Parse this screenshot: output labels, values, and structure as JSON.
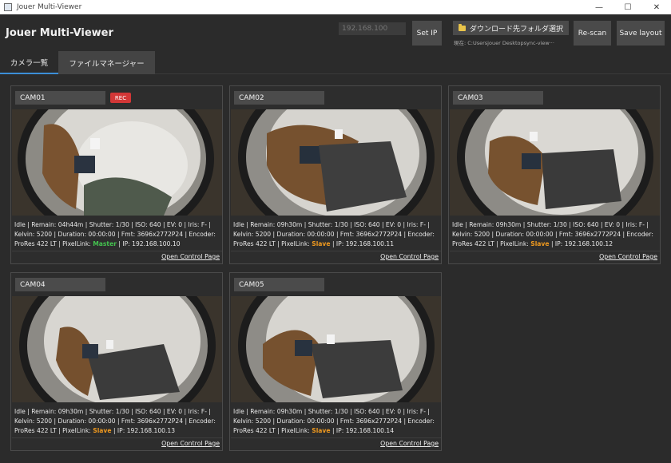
{
  "window": {
    "title": "Jouer Multi-Viewer",
    "minimize": "—",
    "maximize": "☐",
    "close": "✕"
  },
  "header": {
    "app_title": "Jouer Multi-Viewer",
    "ip_placeholder": "192.168.100",
    "set_ip_label": "Set IP",
    "folder_button_label": "ダウンロード先フォルダ選択",
    "folder_path": "現在: C:Usersjouer Desktopsync-view···",
    "rescan_label": "Re-scan",
    "save_layout_label": "Save layout"
  },
  "tabs": [
    {
      "label": "カメラ一覧",
      "active": true
    },
    {
      "label": "ファイルマネージャー",
      "active": false
    }
  ],
  "open_link_label": "Open Control Page",
  "rec_label": "REC",
  "colors": {
    "master": "#44c24f",
    "slave": "#f09a1f",
    "rec": "#d23737",
    "active_tab": "#3c8fd8"
  },
  "cameras": [
    {
      "name": "CAM01",
      "recording": true,
      "line1": "Idle | Remain: 04h44m | Shutter: 1/30 | ISO: 640 | EV: 0 | Iris: F- |",
      "line2": "Kelvin: 5200 | Duration: 00:00:00 | Fmt: 3696x2772P24 | Encoder:",
      "line3_pre": "ProRes 422 LT | PixelLink: ",
      "mode": "Master",
      "line3_post": " | IP: 192.168.100.10"
    },
    {
      "name": "CAM02",
      "recording": false,
      "line1": "Idle | Remain: 09h30m | Shutter: 1/30 | ISO: 640 | EV: 0 | Iris: F- |",
      "line2": "Kelvin: 5200 | Duration: 00:00:00 | Fmt: 3696x2772P24 | Encoder:",
      "line3_pre": "ProRes 422 LT | PixelLink: ",
      "mode": "Slave",
      "line3_post": " | IP: 192.168.100.11"
    },
    {
      "name": "CAM03",
      "recording": false,
      "line1": "Idle | Remain: 09h30m | Shutter: 1/30 | ISO: 640 | EV: 0 | Iris: F- |",
      "line2": "Kelvin: 5200 | Duration: 00:00:00 | Fmt: 3696x2772P24 | Encoder:",
      "line3_pre": "ProRes 422 LT | PixelLink: ",
      "mode": "Slave",
      "line3_post": " | IP: 192.168.100.12"
    },
    {
      "name": "CAM04",
      "recording": false,
      "line1": "Idle | Remain: 09h30m | Shutter: 1/30 | ISO: 640 | EV: 0 | Iris: F- |",
      "line2": "Kelvin: 5200 | Duration: 00:00:00 | Fmt: 3696x2772P24 | Encoder:",
      "line3_pre": "ProRes 422 LT | PixelLink: ",
      "mode": "Slave",
      "line3_post": " | IP: 192.168.100.13"
    },
    {
      "name": "CAM05",
      "recording": false,
      "line1": "Idle | Remain: 09h30m | Shutter: 1/30 | ISO: 640 | EV: 0 | Iris: F- |",
      "line2": "Kelvin: 5200 | Duration: 00:00:00 | Fmt: 3696x2772P24 | Encoder:",
      "line3_pre": "ProRes 422 LT | PixelLink: ",
      "mode": "Slave",
      "line3_post": " | IP: 192.168.100.14"
    }
  ]
}
